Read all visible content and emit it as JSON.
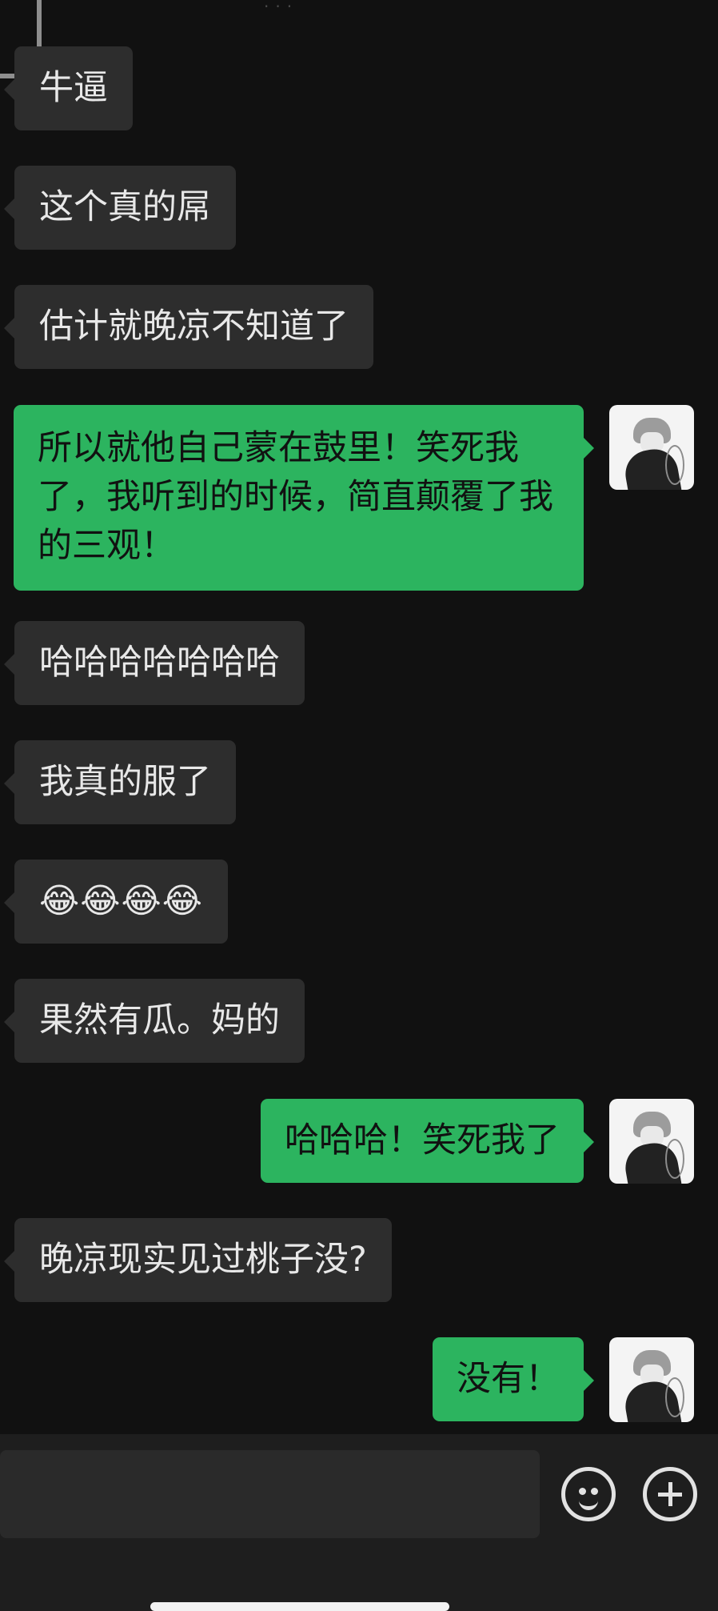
{
  "header": {
    "truncated_indicator": "···"
  },
  "messages": [
    {
      "sender": "other",
      "text": "牛逼"
    },
    {
      "sender": "other",
      "text": "这个真的屌"
    },
    {
      "sender": "other",
      "text": "估计就晚凉不知道了"
    },
    {
      "sender": "me",
      "text": "所以就他自己蒙在鼓里！笑死我了，我听到的时候，简直颠覆了我的三观！"
    },
    {
      "sender": "other",
      "text": "哈哈哈哈哈哈哈"
    },
    {
      "sender": "other",
      "text": "我真的服了"
    },
    {
      "sender": "other",
      "text": "😂😂😂😂"
    },
    {
      "sender": "other",
      "text": "果然有瓜。妈的"
    },
    {
      "sender": "me",
      "text": "哈哈哈！笑死我了"
    },
    {
      "sender": "other",
      "text": "晚凉现实见过桃子没?"
    },
    {
      "sender": "me",
      "text": "没有！"
    }
  ],
  "input_bar": {
    "placeholder": "",
    "emoji_button_icon": "smile-icon",
    "more_button_icon": "plus-icon"
  },
  "colors": {
    "background": "#111111",
    "incoming_bubble": "#2d2d2d",
    "outgoing_bubble": "#2cb45f",
    "input_bar": "#1e1e1e"
  }
}
